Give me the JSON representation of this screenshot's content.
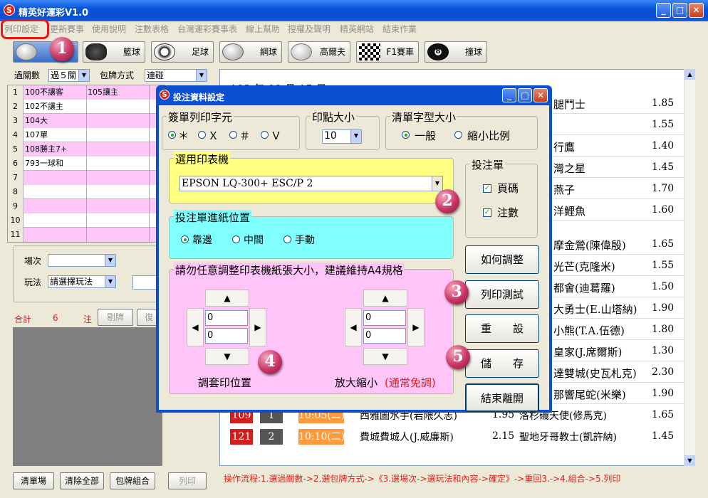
{
  "window": {
    "title": "精英好運彩V1.0",
    "app_icon": "S"
  },
  "menu": [
    "列印設定",
    "更新賽事",
    "使用說明",
    "注數表格",
    "台灣運彩賽事表",
    "線上幫助",
    "授權及聲明",
    "精英網站",
    "結束作業"
  ],
  "sports": [
    {
      "label": "籃球"
    },
    {
      "label": "足球"
    },
    {
      "label": "網球"
    },
    {
      "label": "高爾夫"
    },
    {
      "label": "F1賽車"
    },
    {
      "label": "撞球"
    }
  ],
  "filters": {
    "pass_label": "過關數",
    "pass_value": "過５關",
    "pack_label": "包牌方式",
    "pack_value": "連碰"
  },
  "grid": [
    {
      "n": "1",
      "a": "100不讓客",
      "b": "105讓主",
      "pink": true
    },
    {
      "n": "2",
      "a": "102不讓主",
      "b": "",
      "pink": false
    },
    {
      "n": "3",
      "a": "104大",
      "b": "",
      "pink": true
    },
    {
      "n": "4",
      "a": "107單",
      "b": "",
      "pink": false
    },
    {
      "n": "5",
      "a": "108勝主7+",
      "b": "",
      "pink": true
    },
    {
      "n": "6",
      "a": "793一球和",
      "b": "",
      "pink": false
    },
    {
      "n": "7",
      "a": "",
      "b": "",
      "pink": true
    },
    {
      "n": "8",
      "a": "",
      "b": "",
      "pink": false
    },
    {
      "n": "9",
      "a": "",
      "b": "",
      "pink": true
    },
    {
      "n": "10",
      "a": "",
      "b": "",
      "pink": false
    },
    {
      "n": "11",
      "a": "",
      "b": "",
      "pink": true
    }
  ],
  "left_form": {
    "field_label": "場次",
    "play_label": "玩法",
    "play_value": "請選擇玩法"
  },
  "totals": {
    "label": "合計",
    "count": "6",
    "unit": "注",
    "remove": "剔牌",
    "restore": "復"
  },
  "bottom_buttons": [
    "清單場",
    "清除全部",
    "包牌組合",
    "列印"
  ],
  "status_text": "操作流程:1.選過關數->2.選包牌方式->《3.選場次->選玩法和內容->確定》->重回3.->4.組合->5.列印",
  "right_list": {
    "date_header": "103 年 09 月 15 日",
    "rows": [
      {
        "name": "腿鬥士",
        "odds": "1.85"
      },
      {
        "name": "",
        "odds": "1.55"
      },
      {
        "name": "行鷹",
        "odds": "1.40"
      },
      {
        "name": "灣之星",
        "odds": "1.45"
      },
      {
        "name": "燕子",
        "odds": "1.70"
      },
      {
        "name": "洋鯉魚",
        "odds": "1.60"
      },
      {
        "name": "摩金鶯(陳偉殷)",
        "odds": "1.65"
      },
      {
        "name": "光芒(克隆米)",
        "odds": "1.55"
      },
      {
        "name": "都會(迪葛羅)",
        "odds": "1.50"
      },
      {
        "name": "大勇士(E.山塔納)",
        "odds": "1.90"
      },
      {
        "name": "小熊(T.A.伍德)",
        "odds": "1.80"
      },
      {
        "name": "皇家(J.席爾斯)",
        "odds": "1.30"
      },
      {
        "name": "達雙城(史瓦札克)",
        "odds": "2.30"
      },
      {
        "name": "那響尾蛇(米樂)",
        "odds": "1.90"
      }
    ],
    "game_rows": [
      {
        "id": "109",
        "n": "1",
        "time": "10:05(二)",
        "home": "西雅圖水手(岩隈久志)",
        "home_odds": "1.95",
        "away": "洛杉磯天使(修馬克)",
        "away_odds": "1.65"
      },
      {
        "id": "121",
        "n": "2",
        "time": "10:10(二)",
        "home": "費城費城人(J.威廉斯)",
        "home_odds": "2.15",
        "away": "聖地牙哥教士(凱許納)",
        "away_odds": "1.45"
      }
    ]
  },
  "dialog": {
    "title": "投注資料設定",
    "char_group": "簽單列印字元",
    "char_options": [
      "＊",
      "Ｘ",
      "＃",
      "Ｖ"
    ],
    "dot_group": "印點大小",
    "dot_value": "10",
    "font_group": "清單字型大小",
    "font_options": [
      "一般",
      "縮小比例"
    ],
    "printer_group": "選用印表機",
    "printer_value": "EPSON LQ-300+ ESC/P 2",
    "slip_group": "投注單",
    "slip_options": [
      "頁碼",
      "注數"
    ],
    "feed_group": "投注單進紙位置",
    "feed_options": [
      "靠邊",
      "中間",
      "手動"
    ],
    "paper_group": "請勿任意調整印表機紙張大小，建議維持A4規格",
    "offset_inputs": [
      "0",
      "0"
    ],
    "scale_inputs": [
      "0",
      "0"
    ],
    "offset_label": "調套印位置",
    "scale_label": "放大縮小",
    "scale_note": "(通常免調)",
    "buttons": {
      "adjust": "如何調整",
      "test": "列印測試",
      "reset": "重　　設",
      "save": "儲　　存",
      "close": "結束離開"
    }
  },
  "markers": [
    "1",
    "2",
    "3",
    "4",
    "5"
  ],
  "colors": {
    "titlebar": "#0a4fd0",
    "pink": "#fdc8f8",
    "yellow": "#ffff80",
    "cyan": "#80ffff",
    "magenta_bg": "#ffc4f8",
    "red": "#d21e1e"
  }
}
